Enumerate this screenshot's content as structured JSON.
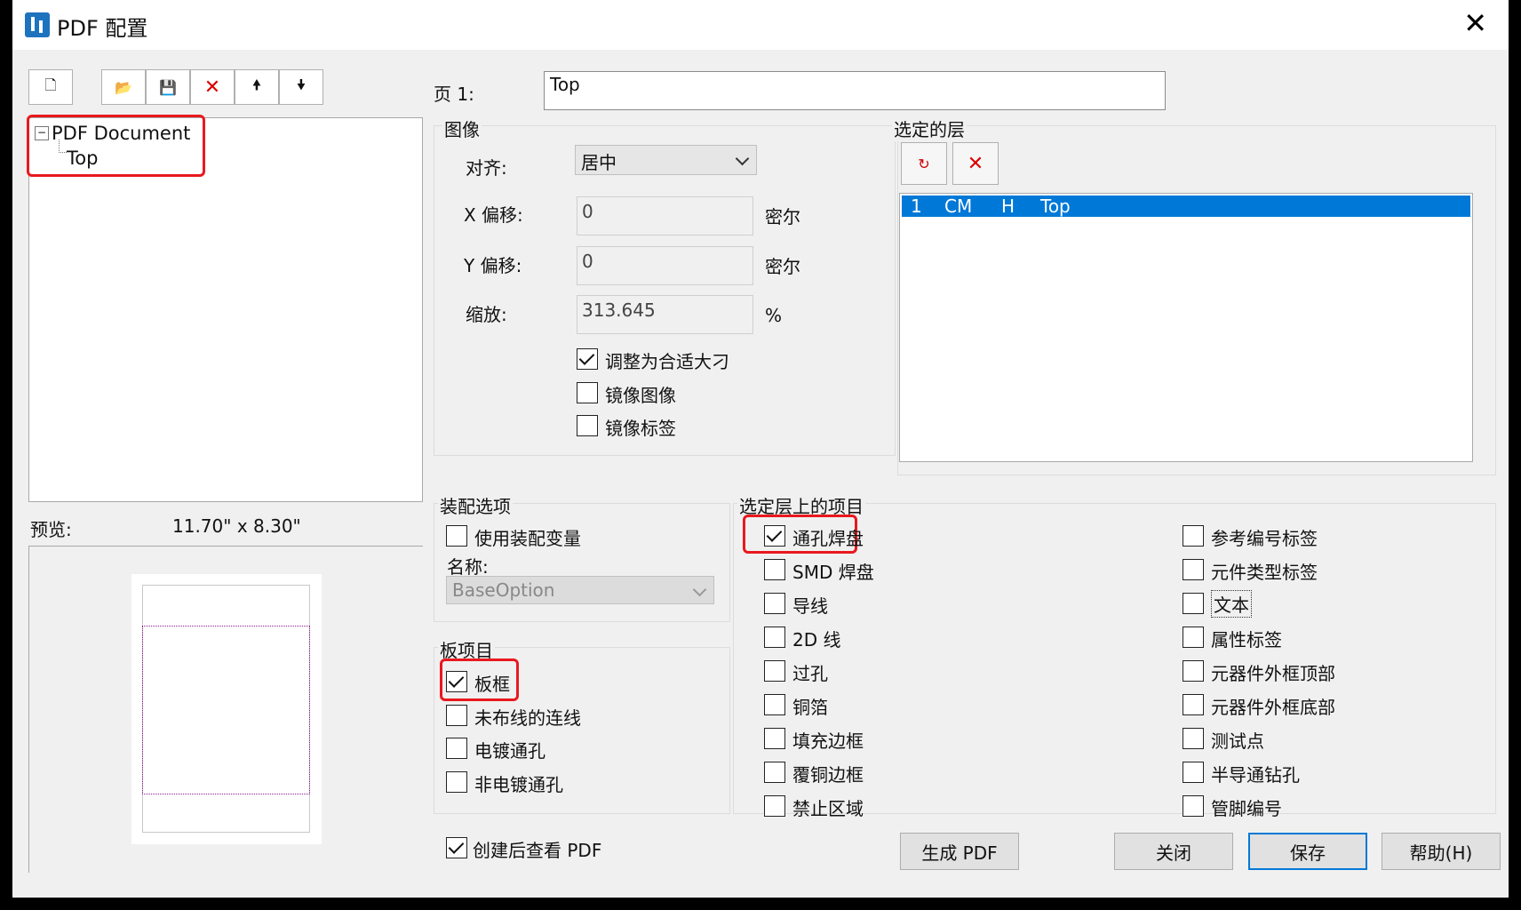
{
  "window": {
    "title": "PDF 配置"
  },
  "toolbar": {
    "new_icon": "🗋",
    "open_icon": "📂",
    "save_icon": "💾",
    "delete_icon": "✕",
    "up_icon": "🠝",
    "down_icon": "🠟"
  },
  "tree": {
    "expander": "−",
    "root": "PDF Document",
    "child": "Top"
  },
  "preview": {
    "label": "预览:",
    "size": "11.70\" x  8.30\""
  },
  "page": {
    "label": "页 1:",
    "name_value": "Top"
  },
  "image_group": {
    "title": "图像",
    "align_label": "对齐:",
    "align_value": "居中",
    "x_offset_label": "X 偏移:",
    "x_offset_value": "0",
    "x_unit": "密尔",
    "y_offset_label": "Y 偏移:",
    "y_offset_value": "0",
    "y_unit": "密尔",
    "scale_label": "缩放:",
    "scale_value": "313.645",
    "scale_unit": "%",
    "fit_label": "调整为合适大刁",
    "fit_checked": true,
    "mirror_image_label": "镜像图像",
    "mirror_image_checked": false,
    "mirror_label_label": "镜像标签",
    "mirror_label_checked": false
  },
  "selected_layers": {
    "title": "选定的层",
    "rows": [
      {
        "num": "1",
        "a": "CM",
        "b": "H",
        "name": "Top"
      }
    ]
  },
  "assembly": {
    "title": "装配选项",
    "use_variant_label": "使用装配变量",
    "name_label": "名称:",
    "name_value": "BaseOption"
  },
  "board_items": {
    "title": "板项目",
    "items": [
      "板框",
      "未布线的连线",
      "电镀通孔",
      "非电镀通孔"
    ],
    "checked": [
      true,
      false,
      false,
      false
    ]
  },
  "layer_items": {
    "title": "选定层上的项目",
    "left": [
      "通孔焊盘",
      "SMD 焊盘",
      "导线",
      "2D 线",
      "过孔",
      "铜箔",
      "填充边框",
      "覆铜边框",
      "禁止区域"
    ],
    "right": [
      "参考编号标签",
      "元件类型标签",
      "文本",
      "属性标签",
      "元器件外框顶部",
      "元器件外框底部",
      "测试点",
      "半导通钻孔",
      "管脚编号"
    ]
  },
  "footer": {
    "view_after_label": "创建后查看 PDF",
    "view_after_checked": true,
    "generate": "生成 PDF",
    "close": "关闭",
    "save": "保存",
    "help": "帮助(H)"
  },
  "colors": {
    "highlight": "#e8191e",
    "selection": "#0078d7"
  }
}
